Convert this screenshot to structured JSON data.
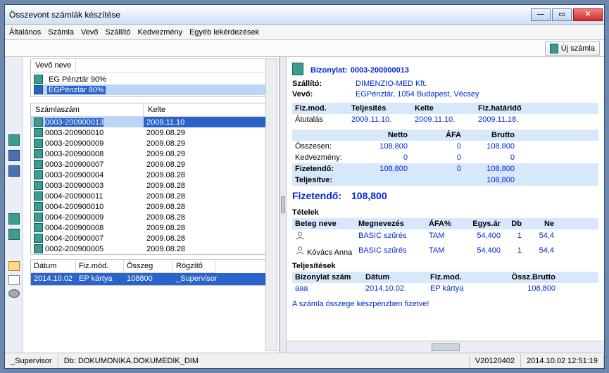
{
  "window": {
    "title": "Összevont számlák készítése"
  },
  "menu": {
    "items": [
      "Általános",
      "Számla",
      "Vevő",
      "Szállító",
      "Kedvezmény",
      "Egyéb lekérdezések"
    ]
  },
  "toolbar": {
    "new_label": "Új számla"
  },
  "vendors": {
    "header": "Vevő neve",
    "items": [
      "EG Pénztár 90%",
      "EGPénztár 80%"
    ],
    "selected_index": 1
  },
  "invoices": {
    "headers": [
      "Számlaszám",
      "Kelte"
    ],
    "rows": [
      {
        "num": "0003-200900013",
        "date": "2009.11.10"
      },
      {
        "num": "0003-200900010",
        "date": "2009.08.29"
      },
      {
        "num": "0003-200900009",
        "date": "2009.08.29"
      },
      {
        "num": "0003-200900008",
        "date": "2009.08.29"
      },
      {
        "num": "0003-200900007",
        "date": "2009.08.29"
      },
      {
        "num": "0003-200900004",
        "date": "2009.08.28"
      },
      {
        "num": "0003-200900003",
        "date": "2009.08.28"
      },
      {
        "num": "0004-200900011",
        "date": "2009.08.28"
      },
      {
        "num": "0004-200900010",
        "date": "2009.08.28"
      },
      {
        "num": "0004-200900009",
        "date": "2009.08.28"
      },
      {
        "num": "0004-200900008",
        "date": "2009.08.28"
      },
      {
        "num": "0004-200900007",
        "date": "2009.08.28"
      },
      {
        "num": "0002-200900005",
        "date": "2009.08.28"
      }
    ],
    "selected_index": 0
  },
  "summary_grid": {
    "headers": [
      "Dátum",
      "Fiz.mód.",
      "Összeg",
      "Rögzítő"
    ],
    "row": {
      "date": "2014.10.02",
      "paymode": "EP kártya",
      "amount": "108800",
      "recorder": "_Supervisor"
    }
  },
  "doc": {
    "title_label": "Bizonylat:",
    "title_num": "0003-200900013",
    "supplier_label": "Szállító:",
    "supplier": "DIMENZIO-MED Kft.",
    "buyer_label": "Vevő:",
    "buyer": "EGPénztár, 1054 Budapest, Vécsey",
    "pay_headers": [
      "Fiz.mod.",
      "Teljesítés",
      "Kelte",
      "Fiz.határidő"
    ],
    "pay_row": [
      "Átutalás",
      "2009.11.10.",
      "2009.11.10.",
      "2009.11.18."
    ],
    "sum_headers": [
      "",
      "Netto",
      "ÁFA",
      "Brutto"
    ],
    "sums": [
      {
        "k": "Összesen:",
        "a": "108,800",
        "b": "0",
        "c": "108,800"
      },
      {
        "k": "Kedvezmény:",
        "a": "0",
        "b": "0",
        "c": "0"
      },
      {
        "k": "Fizetendő:",
        "a": "108,800",
        "b": "0",
        "c": "108,800"
      },
      {
        "k": "Teljesítve:",
        "a": "",
        "b": "",
        "c": "108,800"
      }
    ],
    "payable_label": "Fizetendő:",
    "payable_value": "108,800",
    "items_label": "Tételek",
    "items_headers": [
      "Beteg neve",
      "Megnevezés",
      "ÁFA%",
      "Egys.ár",
      "Db",
      "Ne"
    ],
    "items": [
      {
        "name": "",
        "desc": "BASIC szűrés",
        "vat": "TAM",
        "unit": "54,400",
        "qty": "1",
        "net": "54,4"
      },
      {
        "name": "Kóvács Anna",
        "desc": "BASIC szűrés",
        "vat": "TAM",
        "unit": "54,400",
        "qty": "1",
        "net": "54,4"
      }
    ],
    "perf_label": "Teljesítések",
    "perf_headers": [
      "Bizonylat szám",
      "Dátum",
      "Fiz.mod.",
      "Össz.Brutto"
    ],
    "perf_row": {
      "num": "aaa",
      "date": "2014.10.02.",
      "mode": "EP kártya",
      "total": "108,800"
    },
    "note": "A számla összege készpénzben fizetve!"
  },
  "status": {
    "user": "_Supervisor",
    "db": "Db: DOKUMONIKA.DOKUMEDIK_DIM",
    "ver": "V20120402",
    "time": "2014.10.02 12:51:19"
  }
}
